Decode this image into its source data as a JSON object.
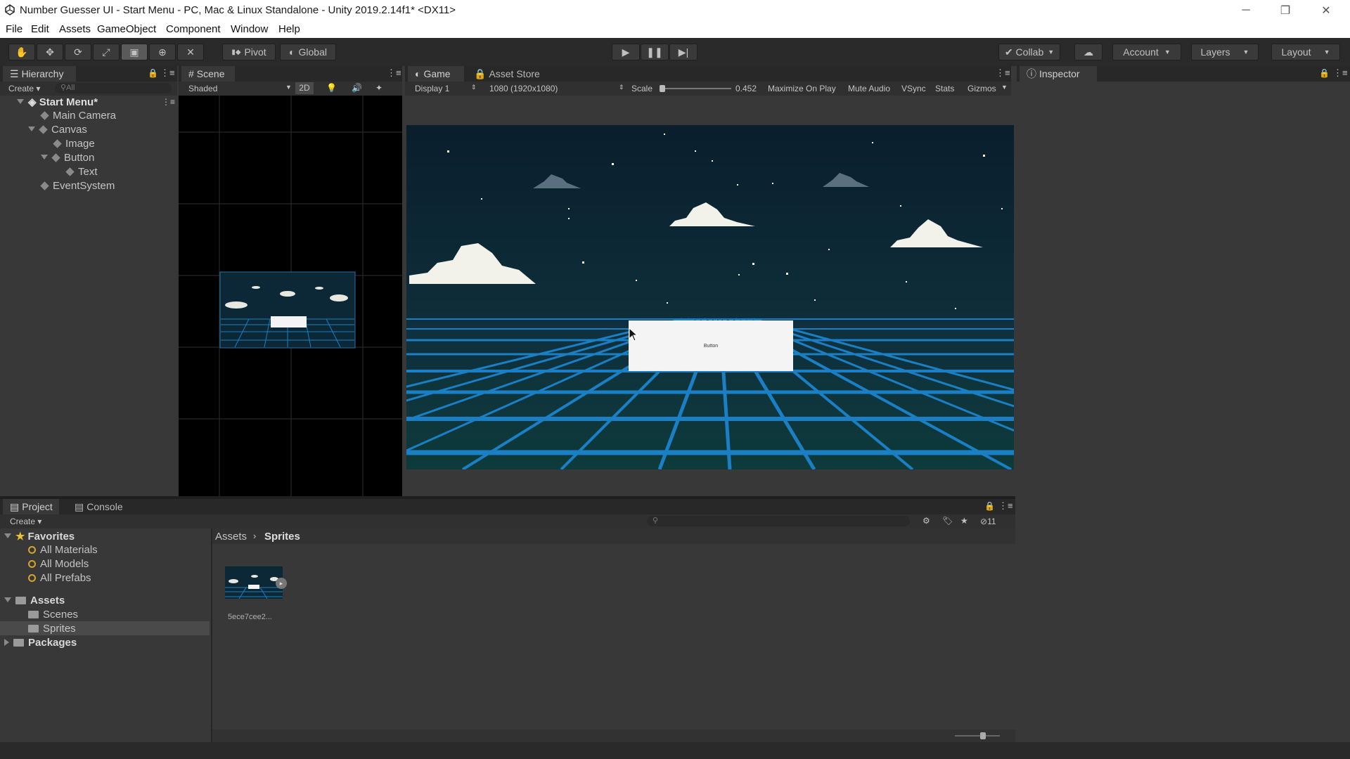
{
  "window": {
    "title": "Number Guesser UI - Start Menu - PC, Mac & Linux Standalone - Unity 2019.2.14f1* <DX11>",
    "minimize": "─",
    "restore": "❐",
    "close": "✕"
  },
  "menu": [
    "File",
    "Edit",
    "Assets",
    "GameObject",
    "Component",
    "Window",
    "Help"
  ],
  "toolbar": {
    "pivot": "Pivot",
    "global": "Global",
    "collab": "Collab",
    "account": "Account",
    "layers": "Layers",
    "layout": "Layout"
  },
  "hierarchy": {
    "tab": "Hierarchy",
    "create": "Create",
    "search_placeholder": "All",
    "scene": "Start Menu*",
    "items": [
      "Main Camera",
      "Canvas",
      "Image",
      "Button",
      "Text",
      "EventSystem"
    ]
  },
  "scene": {
    "tab": "Scene",
    "shading": "Shaded",
    "mode2d": "2D"
  },
  "game": {
    "tab": "Game",
    "asset_store_tab": "Asset Store",
    "display": "Display 1",
    "resolution": "1080 (1920x1080)",
    "scale_label": "Scale",
    "scale_value": "0.452",
    "maximize": "Maximize On Play",
    "mute": "Mute Audio",
    "vsync": "VSync",
    "stats": "Stats",
    "gizmos": "Gizmos",
    "button_text": "Button"
  },
  "inspector": {
    "tab": "Inspector"
  },
  "project": {
    "tab": "Project",
    "console_tab": "Console",
    "create": "Create",
    "favorites_label": "Favorites",
    "favorites": [
      "All Materials",
      "All Models",
      "All Prefabs"
    ],
    "assets_label": "Assets",
    "asset_folders": [
      "Scenes",
      "Sprites"
    ],
    "packages_label": "Packages",
    "breadcrumb": [
      "Assets",
      "Sprites"
    ],
    "hidden_count": "11",
    "files": [
      {
        "name": "5ece7cee2..."
      }
    ]
  },
  "colors": {
    "editor_bg": "#383838",
    "toolbar_bg": "#2a2a2a",
    "sky": "#0b2430",
    "grid": "#1a7fc4",
    "button_face": "#f4f4f4"
  }
}
